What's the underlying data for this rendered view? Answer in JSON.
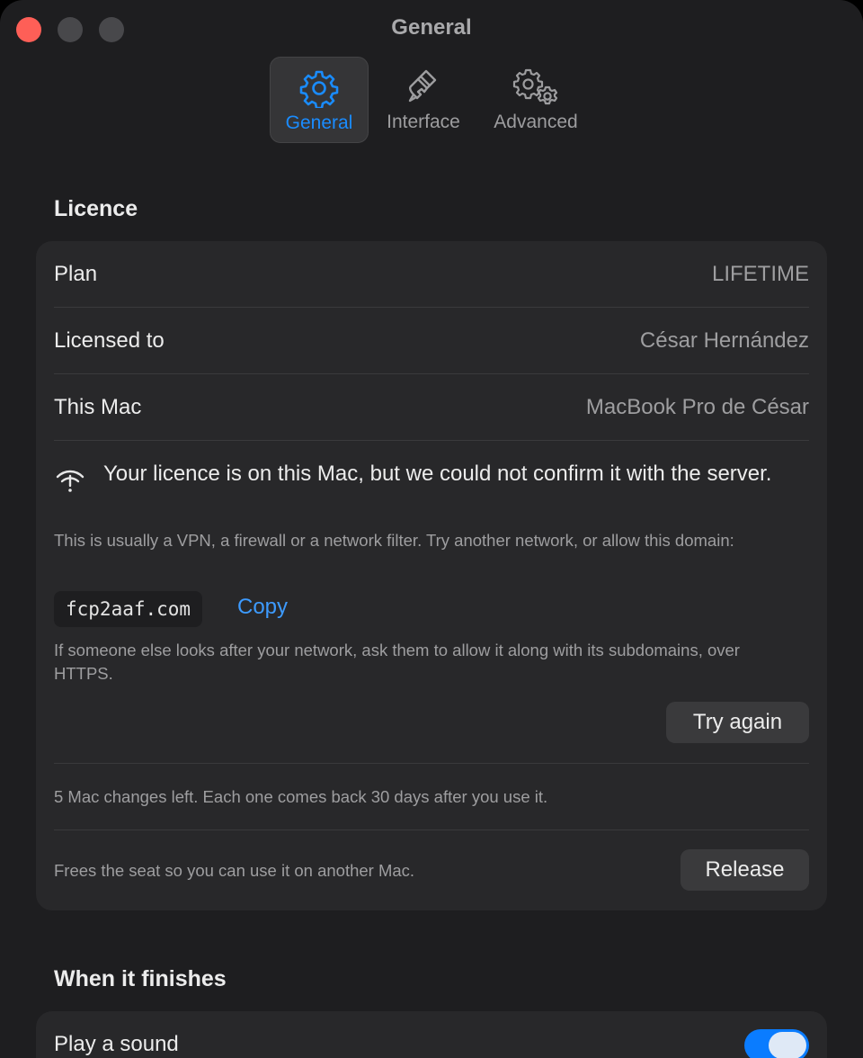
{
  "window": {
    "title": "General"
  },
  "tabs": [
    {
      "label": "General",
      "icon": "gear-icon",
      "active": true
    },
    {
      "label": "Interface",
      "icon": "paintbrush-icon",
      "active": false
    },
    {
      "label": "Advanced",
      "icon": "gears-icon",
      "active": false
    }
  ],
  "licence": {
    "title": "Licence",
    "plan": {
      "label": "Plan",
      "value": "LIFETIME"
    },
    "licensed_to": {
      "label": "Licensed to",
      "value": "César Hernández"
    },
    "this_mac": {
      "label": "This Mac",
      "value": "MacBook Pro de César"
    },
    "warning": {
      "icon": "wifi-exclamation-icon",
      "heading": "Your licence is on this Mac, but we could not confirm it with the server.",
      "explanation": "This is usually a VPN, a firewall or a network filter. Try another network, or allow this domain:",
      "domain": "fcp2aaf.com",
      "copy_label": "Copy",
      "note": "If someone else looks after your network, ask them to allow it along with its subdomains, over HTTPS.",
      "retry_label": "Try again"
    },
    "changes_left": "5 Mac changes left. Each one comes back 30 days after you use it.",
    "release": {
      "description": "Frees the seat so you can use it on another Mac.",
      "button_label": "Release"
    }
  },
  "finish": {
    "title": "When it finishes",
    "play_sound": {
      "label": "Play a sound",
      "enabled": true
    }
  },
  "colors": {
    "accent": "#1a8cff",
    "link": "#3d9bff",
    "close": "#fe5f57",
    "toggle_on": "#0a7cff"
  }
}
